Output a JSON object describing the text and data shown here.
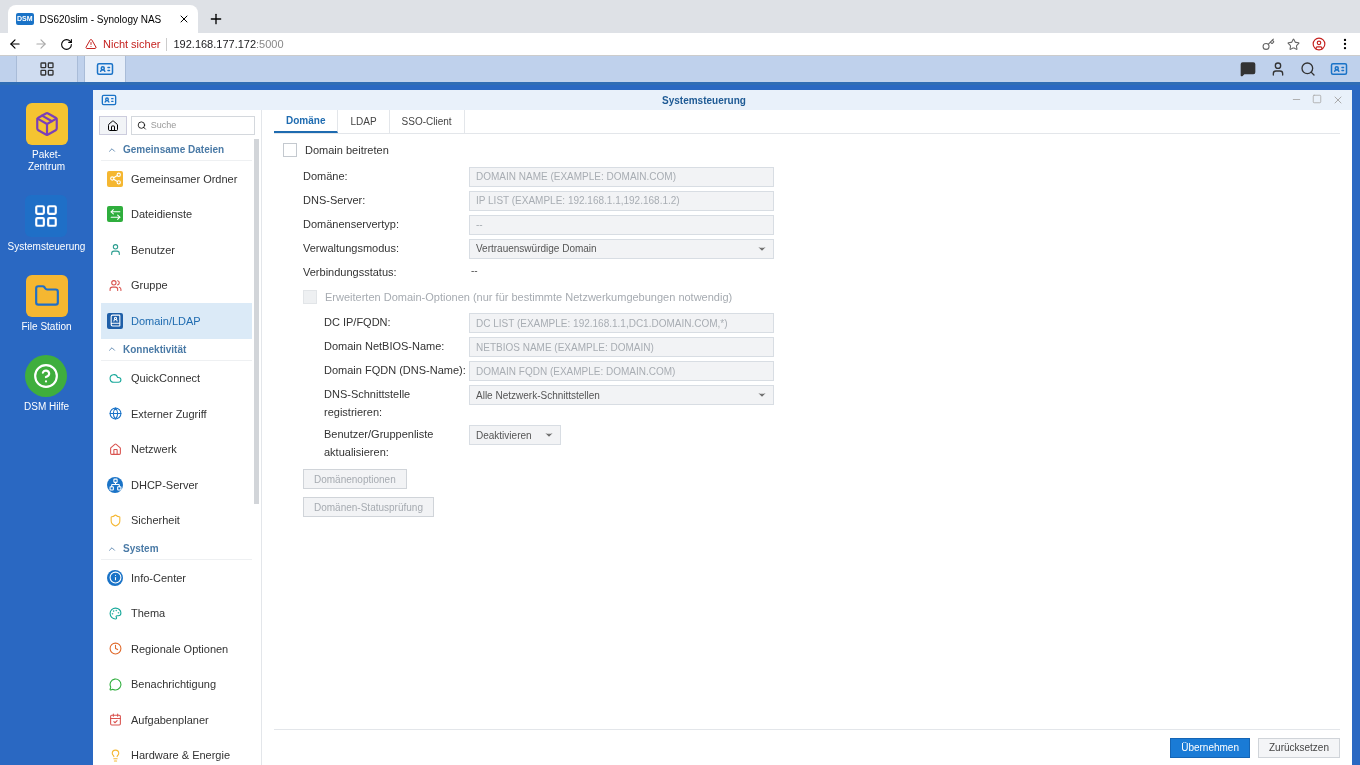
{
  "browser": {
    "tab_title": "DS620slim - Synology NAS",
    "tab_favicon": "DSM",
    "security": "Nicht sicher",
    "url_host": "192.168.177.172",
    "url_port": ":5000"
  },
  "desktop_icons": [
    {
      "label": "Paket-\nZentrum"
    },
    {
      "label": "Systemsteuerung"
    },
    {
      "label": "File Station"
    },
    {
      "label": "DSM Hilfe"
    }
  ],
  "window": {
    "title": "Systemsteuerung"
  },
  "search": {
    "placeholder": "Suche"
  },
  "sidebar": [
    {
      "title": "Gemeinsame Dateien",
      "expanded": true,
      "items": [
        {
          "label": "Gemeinsamer Ordner",
          "selected": false
        },
        {
          "label": "Dateidienste",
          "selected": false
        },
        {
          "label": "Benutzer",
          "selected": false
        },
        {
          "label": "Gruppe",
          "selected": false
        },
        {
          "label": "Domain/LDAP",
          "selected": true
        }
      ]
    },
    {
      "title": "Konnektivität",
      "expanded": true,
      "items": [
        {
          "label": "QuickConnect",
          "selected": false
        },
        {
          "label": "Externer Zugriff",
          "selected": false
        },
        {
          "label": "Netzwerk",
          "selected": false
        },
        {
          "label": "DHCP-Server",
          "selected": false
        },
        {
          "label": "Sicherheit",
          "selected": false
        }
      ]
    },
    {
      "title": "System",
      "expanded": true,
      "items": [
        {
          "label": "Info-Center",
          "selected": false
        },
        {
          "label": "Thema",
          "selected": false
        },
        {
          "label": "Regionale Optionen",
          "selected": false
        },
        {
          "label": "Benachrichtigung",
          "selected": false
        },
        {
          "label": "Aufgabenplaner",
          "selected": false
        },
        {
          "label": "Hardware & Energie",
          "selected": false
        }
      ]
    }
  ],
  "tabs": [
    {
      "label": "Domäne",
      "selected": true
    },
    {
      "label": "LDAP",
      "selected": false
    },
    {
      "label": "SSO-Client",
      "selected": false
    }
  ],
  "join_domain": {
    "label": "Domain beitreten",
    "checked": false
  },
  "fields": [
    {
      "label": "Domäne:",
      "kind": "text",
      "placeholder": "DOMAIN NAME (EXAMPLE: DOMAIN.COM)"
    },
    {
      "label": "DNS-Server:",
      "kind": "text",
      "placeholder": "IP LIST (EXAMPLE: 192.168.1.1,192.168.1.2)"
    },
    {
      "label": "Domänenservertyp:",
      "kind": "text",
      "placeholder": "--"
    },
    {
      "label": "Verwaltungsmodus:",
      "kind": "select",
      "value": "Vertrauenswürdige Domain"
    },
    {
      "label": "Verbindungsstatus:",
      "kind": "static",
      "value": "--"
    }
  ],
  "advanced": {
    "label": "Erweiterten Domain-Optionen (nur für bestimmte Netzwerkumgebungen notwendig)",
    "checked": false,
    "disabled": true
  },
  "advanced_fields": [
    {
      "label": "DC IP/FQDN:",
      "kind": "text",
      "placeholder": "DC LIST (EXAMPLE: 192.168.1.1,DC1.DOMAIN.COM,*)"
    },
    {
      "label": "Domain NetBIOS-Name:",
      "kind": "text",
      "placeholder": "NETBIOS NAME (EXAMPLE: DOMAIN)"
    },
    {
      "label": "Domain FQDN (DNS-Name):",
      "kind": "text",
      "placeholder": "DOMAIN FQDN (EXAMPLE: DOMAIN.COM)"
    },
    {
      "label": "DNS-Schnittstelle registrieren:",
      "kind": "select",
      "value": "Alle Netzwerk-Schnittstellen"
    },
    {
      "label": "Benutzer/Gruppenliste aktualisieren:",
      "kind": "small-select",
      "value": "Deaktivieren"
    }
  ],
  "option_buttons": [
    {
      "label": "Domänenoptionen",
      "disabled": true
    },
    {
      "label": "Domänen-Statusprüfung",
      "disabled": true
    }
  ],
  "footer_buttons": [
    {
      "label": "Übernehmen",
      "kind": "primary"
    },
    {
      "label": "Zurücksetzen",
      "kind": "secondary"
    }
  ]
}
